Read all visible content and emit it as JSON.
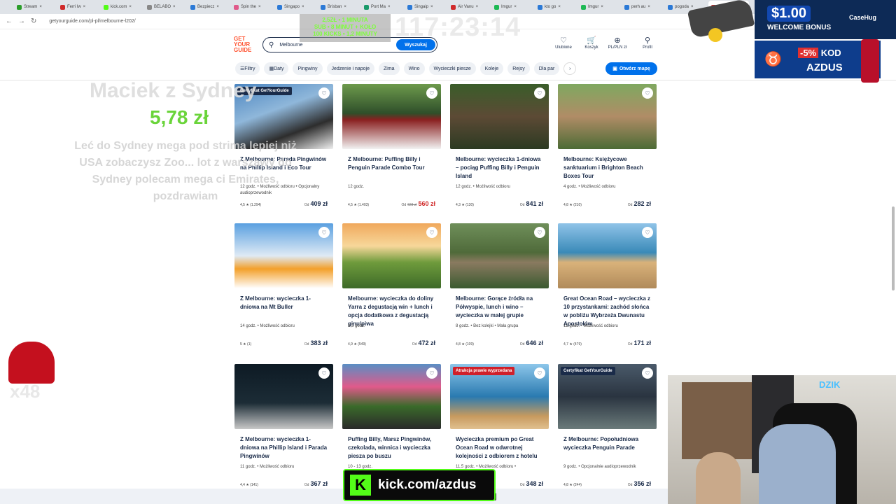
{
  "browser": {
    "tabs": [
      "Stream",
      "Ferri lw",
      "kick.com",
      "BELABO",
      "Bezpiecz",
      "Spin the",
      "Singapo",
      "Brisban",
      "Port Ma",
      "Singaip",
      "Air Vanu",
      "Imgur",
      "kto go",
      "Imgur",
      "perh au",
      "pogoda",
      "Melbourne"
    ],
    "active_tab_index": 16,
    "url": "getyourguide.com/pl-pl/melbourne-l202/"
  },
  "header": {
    "logo": "GET YOUR GUIDE",
    "search_value": "Melbourne",
    "search_button": "Wyszukaj",
    "icons": [
      {
        "label": "Ulubione",
        "icon": "heart-icon",
        "glyph": "♡"
      },
      {
        "label": "Koszyk",
        "icon": "cart-icon",
        "glyph": "🛒"
      },
      {
        "label": "PL/PLN zł",
        "icon": "globe-icon",
        "glyph": "⊕"
      },
      {
        "label": "Profil",
        "icon": "profile-icon",
        "glyph": "⚲"
      }
    ]
  },
  "filters": [
    "Filtry",
    "Daty",
    "Pingwiny",
    "Jedzenie i napoje",
    "Zima",
    "Wino",
    "Wycieczki piesze",
    "Koleje",
    "Rejsy",
    "Dla par"
  ],
  "map_button": "Otwórz mapę",
  "cards": [
    {
      "title": "Z Melbourne: Parada Pingwinów na Phillip Island i Eco Tour",
      "meta": "12 godz. • Możliwość odbioru • Opcjonalny audioprzewodnik",
      "rating": "4,5 ★ (1.294)",
      "from": "Od",
      "price": "409 zł",
      "old": "",
      "badge": "Certyfikat GetYourGuide",
      "badge_color": "#1a2b49",
      "img": "linear-gradient(160deg,#4a84c0 0%,#8fb7da 40%,#2d2d2d 70%,#f0f0f0 100%)"
    },
    {
      "title": "Z Melbourne: Puffing Billy i Penguin Parade Combo Tour",
      "meta": "12 godz.",
      "rating": "4,5 ★ (1.403)",
      "from": "Od",
      "price": "560 zł",
      "old": "623 zł",
      "badge": "",
      "badge_color": "",
      "img": "linear-gradient(180deg,#6d9a4c 0%,#2f4f2a 45%,#8a2020 55%,#f2f2f2 100%)"
    },
    {
      "title": "Melbourne: wycieczka 1-dniowa – pociąg Puffing Billy i Penguin Island",
      "meta": "12 godz. • Możliwość odbioru",
      "rating": "4,3 ★ (130)",
      "from": "Od",
      "price": "841 zł",
      "old": "",
      "badge": "",
      "badge_color": "",
      "img": "linear-gradient(180deg,#3a5d2a 0%,#5c4a35 50%,#2c3a22 100%)"
    },
    {
      "title": "Melbourne: Księżycowe sanktuarium i Brighton Beach Boxes Tour",
      "meta": "4 godz. • Możliwość odbioru",
      "rating": "4,8 ★ (210)",
      "from": "Od",
      "price": "282 zł",
      "old": "",
      "badge": "",
      "badge_color": "",
      "img": "linear-gradient(180deg,#7fa860 0%,#b08c66 50%,#4c6b35 100%)"
    },
    {
      "title": "Z Melbourne: wycieczka 1-dniowa na Mt Buller",
      "meta": "14 godz. • Możliwość odbioru",
      "rating": "5 ★ (1)",
      "from": "Od",
      "price": "383 zł",
      "old": "",
      "badge": "",
      "badge_color": "",
      "img": "linear-gradient(180deg,#5aa0e0 0%,#dfeaf5 50%,#f3a02a 70%,#ffffff 100%)"
    },
    {
      "title": "Melbourne: wycieczka do doliny Yarra z degustacją win + lunch i opcja dodatkowa z degustacją ginu/piwa",
      "meta": "8,5 godz.",
      "rating": "4,9 ★ (549)",
      "from": "Od",
      "price": "472 zł",
      "old": "",
      "badge": "",
      "badge_color": "",
      "img": "linear-gradient(180deg,#f0a85c 0%,#f7d79a 35%,#6f9b3c 60%,#3d6a28 100%)"
    },
    {
      "title": "Melbourne: Gorące źródła na Półwyspie, lunch i wino – wycieczka w małej grupie",
      "meta": "8 godz. • Bez kolejki • Mała grupa",
      "rating": "4,8 ★ (109)",
      "from": "Od",
      "price": "646 zł",
      "old": "",
      "badge": "",
      "badge_color": "",
      "img": "linear-gradient(180deg,#6f8f5a 0%,#4f6a3a 45%,#8a7a60 60%,#3a5a30 100%)"
    },
    {
      "title": "Great Ocean Road – wycieczka z 10 przystankami: zachód słońca w pobliżu Wybrzeża Dwunastu Apostołów",
      "meta": "12 godz. • Możliwość odbioru",
      "rating": "4,7 ★ (479)",
      "from": "Od",
      "price": "171 zł",
      "old": "",
      "badge": "",
      "badge_color": "",
      "img": "linear-gradient(180deg,#8fc3e8 0%,#3a8ab8 45%,#d9b27a 60%,#b08a5a 100%)"
    },
    {
      "title": "Z Melbourne: wycieczka 1-dniowa na Phillip Island i Parada Pingwinów",
      "meta": "11 godz. • Możliwość odbioru",
      "rating": "4,4 ★ (141)",
      "from": "Od",
      "price": "367 zł",
      "old": "",
      "badge": "",
      "badge_color": "",
      "img": "linear-gradient(180deg,#0d1a24 0%,#1c2c36 60%,#c8c8c8 100%)"
    },
    {
      "title": "Puffing Billy, Marsz Pingwinów, czekolada, winnica i wycieczka piesza po buszu",
      "meta": "10 - 13 godz.",
      "rating": "",
      "from": "",
      "price": "",
      "old": "",
      "badge": "",
      "badge_color": "",
      "img": "linear-gradient(180deg,#5a8ec4 0%,#e05a8a 35%,#3a6a2a 65%,#2a2a2a 100%)"
    },
    {
      "title": "Wycieczka premium po Great Ocean Road w odwrotnej kolejności z odbiorem z hotelu",
      "meta": "11,5 godz. • Możliwość odbioru •",
      "rating": "",
      "from": "Od",
      "price": "348 zł",
      "old": "",
      "badge": "Atrakcja prawie wyprzedana",
      "badge_color": "#d0202a",
      "img": "linear-gradient(180deg,#8cc6ea 0%,#2a7ab0 50%,#c79a5e 80%,#e0c090 100%)"
    },
    {
      "title": "Z Melbourne: Popołudniowa wycieczka Penguin Parade",
      "meta": "9 godz. • Opcjonalnie audioprzewodnik",
      "rating": "4,8 ★ (244)",
      "from": "Od",
      "price": "356 zł",
      "old": "",
      "badge": "Certyfikat GetYourGuide",
      "badge_color": "#1a2b49",
      "img": "linear-gradient(180deg,#4a5a6a 0%,#2a3440 50%,#6a7a7a 100%)"
    }
  ],
  "overlay": {
    "sub_timer": [
      "2,5ZŁ • 1 MINUTA",
      "SUB • 8 MINUT + KOŁO",
      "100 KICKS • 1,2 MINUTY"
    ],
    "clock": "117:23:14",
    "donor": "Maciek z Sydney",
    "amount": "5,78 zł",
    "message": "Leć do Sydney mega pod strima lepiej niż USA zobaczysz Zoo... lot z warszawy do Sydney polecam mega ci Emirates, pozdrawiam",
    "promo_amount": "$1.00",
    "promo_text": "WELCOME BONUS",
    "promo_brand": "CaseHug",
    "code_percent": "-5%",
    "code_label": "KOD",
    "code": "AZDUS",
    "multiplier": "x48",
    "cam_label": "DZIK",
    "kick": "kick.com/azdus"
  },
  "colors": {
    "accent": "#0071eb",
    "brand": "#ff5533",
    "sale": "#d02a2a",
    "kick": "#53fc18"
  }
}
